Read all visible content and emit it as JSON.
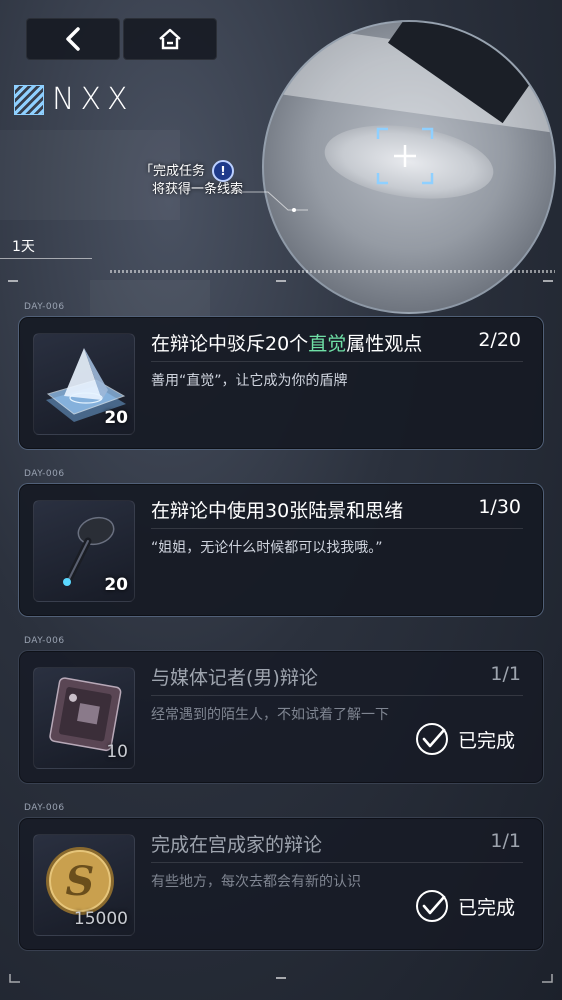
{
  "nav": {
    "back_icon": "chevron-left-icon",
    "home_icon": "home-icon"
  },
  "logo": {
    "text": "NXX"
  },
  "hint": {
    "line1": "「完成任务",
    "line2": "将获得一条线索",
    "icon": "!"
  },
  "day": {
    "label": "1天"
  },
  "missions": [
    {
      "tag": "DAY-006",
      "title_pre": "在辩论中驳斥20个",
      "title_hl": "直觉",
      "title_post": "属性观点",
      "progress": "2/20",
      "desc": "善用“直觉”，让它成为你的盾牌",
      "reward_count": "20",
      "reward_icon": "crystal-pyramid-icon",
      "completed": false
    },
    {
      "tag": "DAY-006",
      "title_pre": "在辩论中使用30张陆景和思绪",
      "title_hl": "",
      "title_post": "",
      "progress": "1/30",
      "desc": "“姐姐，无论什么时候都可以找我哦。”",
      "reward_count": "20",
      "reward_icon": "earphone-icon",
      "completed": false
    },
    {
      "tag": "DAY-006",
      "title_pre": "与媒体记者(男)辩论",
      "title_hl": "",
      "title_post": "",
      "progress": "1/1",
      "desc": "经常遇到的陌生人，不如试着了解一下",
      "reward_count": "10",
      "reward_icon": "chip-icon",
      "completed": true,
      "status": "已完成"
    },
    {
      "tag": "DAY-006",
      "title_pre": "完成在宫成家的辩论",
      "title_hl": "",
      "title_post": "",
      "progress": "1/1",
      "desc": "有些地方，每次去都会有新的认识",
      "reward_count": "15000",
      "reward_icon": "gold-coin-icon",
      "completed": true,
      "status": "已完成"
    }
  ],
  "colors": {
    "highlight": "#6fe0a6",
    "accent_blue": "#8fd0ff"
  }
}
